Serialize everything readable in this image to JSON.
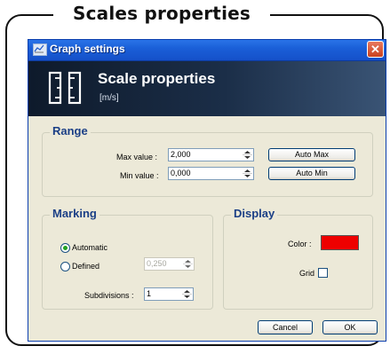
{
  "heading": "Scales properties",
  "window": {
    "title": "Graph settings",
    "close_glyph": "✕"
  },
  "banner": {
    "title": "Scale properties",
    "unit": "[m/s]"
  },
  "range": {
    "title": "Range",
    "max_label": "Max value :",
    "max_value": "2,000",
    "min_label": "Min value :",
    "min_value": "0,000",
    "auto_max_label": "Auto Max",
    "auto_min_label": "Auto Min"
  },
  "marking": {
    "title": "Marking",
    "automatic_label": "Automatic",
    "automatic_selected": true,
    "defined_label": "Defined",
    "defined_value": "0,250",
    "subdivisions_label": "Subdivisions :",
    "subdivisions_value": "1"
  },
  "display": {
    "title": "Display",
    "color_label": "Color :",
    "color_value": "#ee0000",
    "grid_label": "Grid",
    "grid_checked": false
  },
  "footer": {
    "cancel_label": "Cancel",
    "ok_label": "OK"
  }
}
